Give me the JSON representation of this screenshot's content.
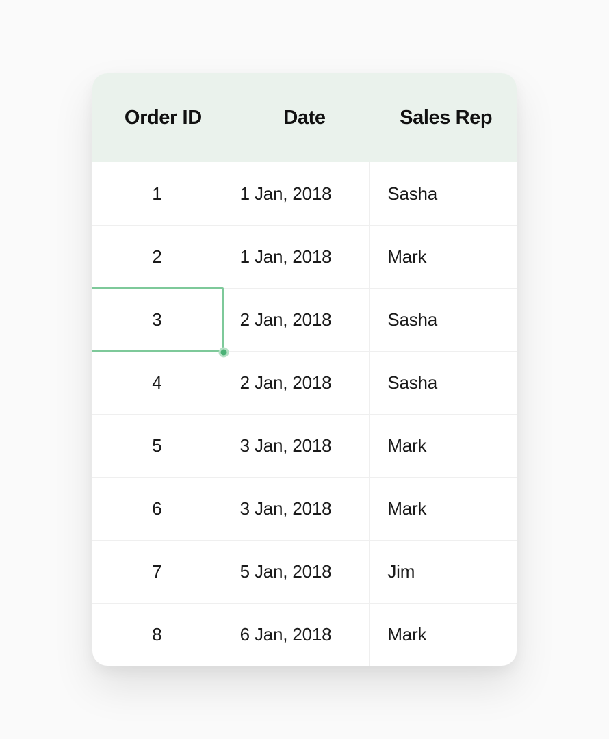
{
  "table": {
    "headers": [
      "Order ID",
      "Date",
      "Sales Rep"
    ],
    "rows": [
      {
        "id": "1",
        "date": "1 Jan, 2018",
        "rep": "Sasha"
      },
      {
        "id": "2",
        "date": "1 Jan, 2018",
        "rep": "Mark"
      },
      {
        "id": "3",
        "date": "2 Jan, 2018",
        "rep": "Sasha"
      },
      {
        "id": "4",
        "date": "2 Jan, 2018",
        "rep": "Sasha"
      },
      {
        "id": "5",
        "date": "3 Jan, 2018",
        "rep": "Mark"
      },
      {
        "id": "6",
        "date": "3 Jan, 2018",
        "rep": "Mark"
      },
      {
        "id": "7",
        "date": "5 Jan, 2018",
        "rep": "Jim"
      },
      {
        "id": "8",
        "date": "6 Jan, 2018",
        "rep": "Mark"
      }
    ],
    "selected": {
      "row": 2,
      "col": 0
    }
  },
  "colors": {
    "header_bg": "#eaf2ec",
    "selection_border": "#7ec99a",
    "selection_handle": "#4bb176"
  }
}
